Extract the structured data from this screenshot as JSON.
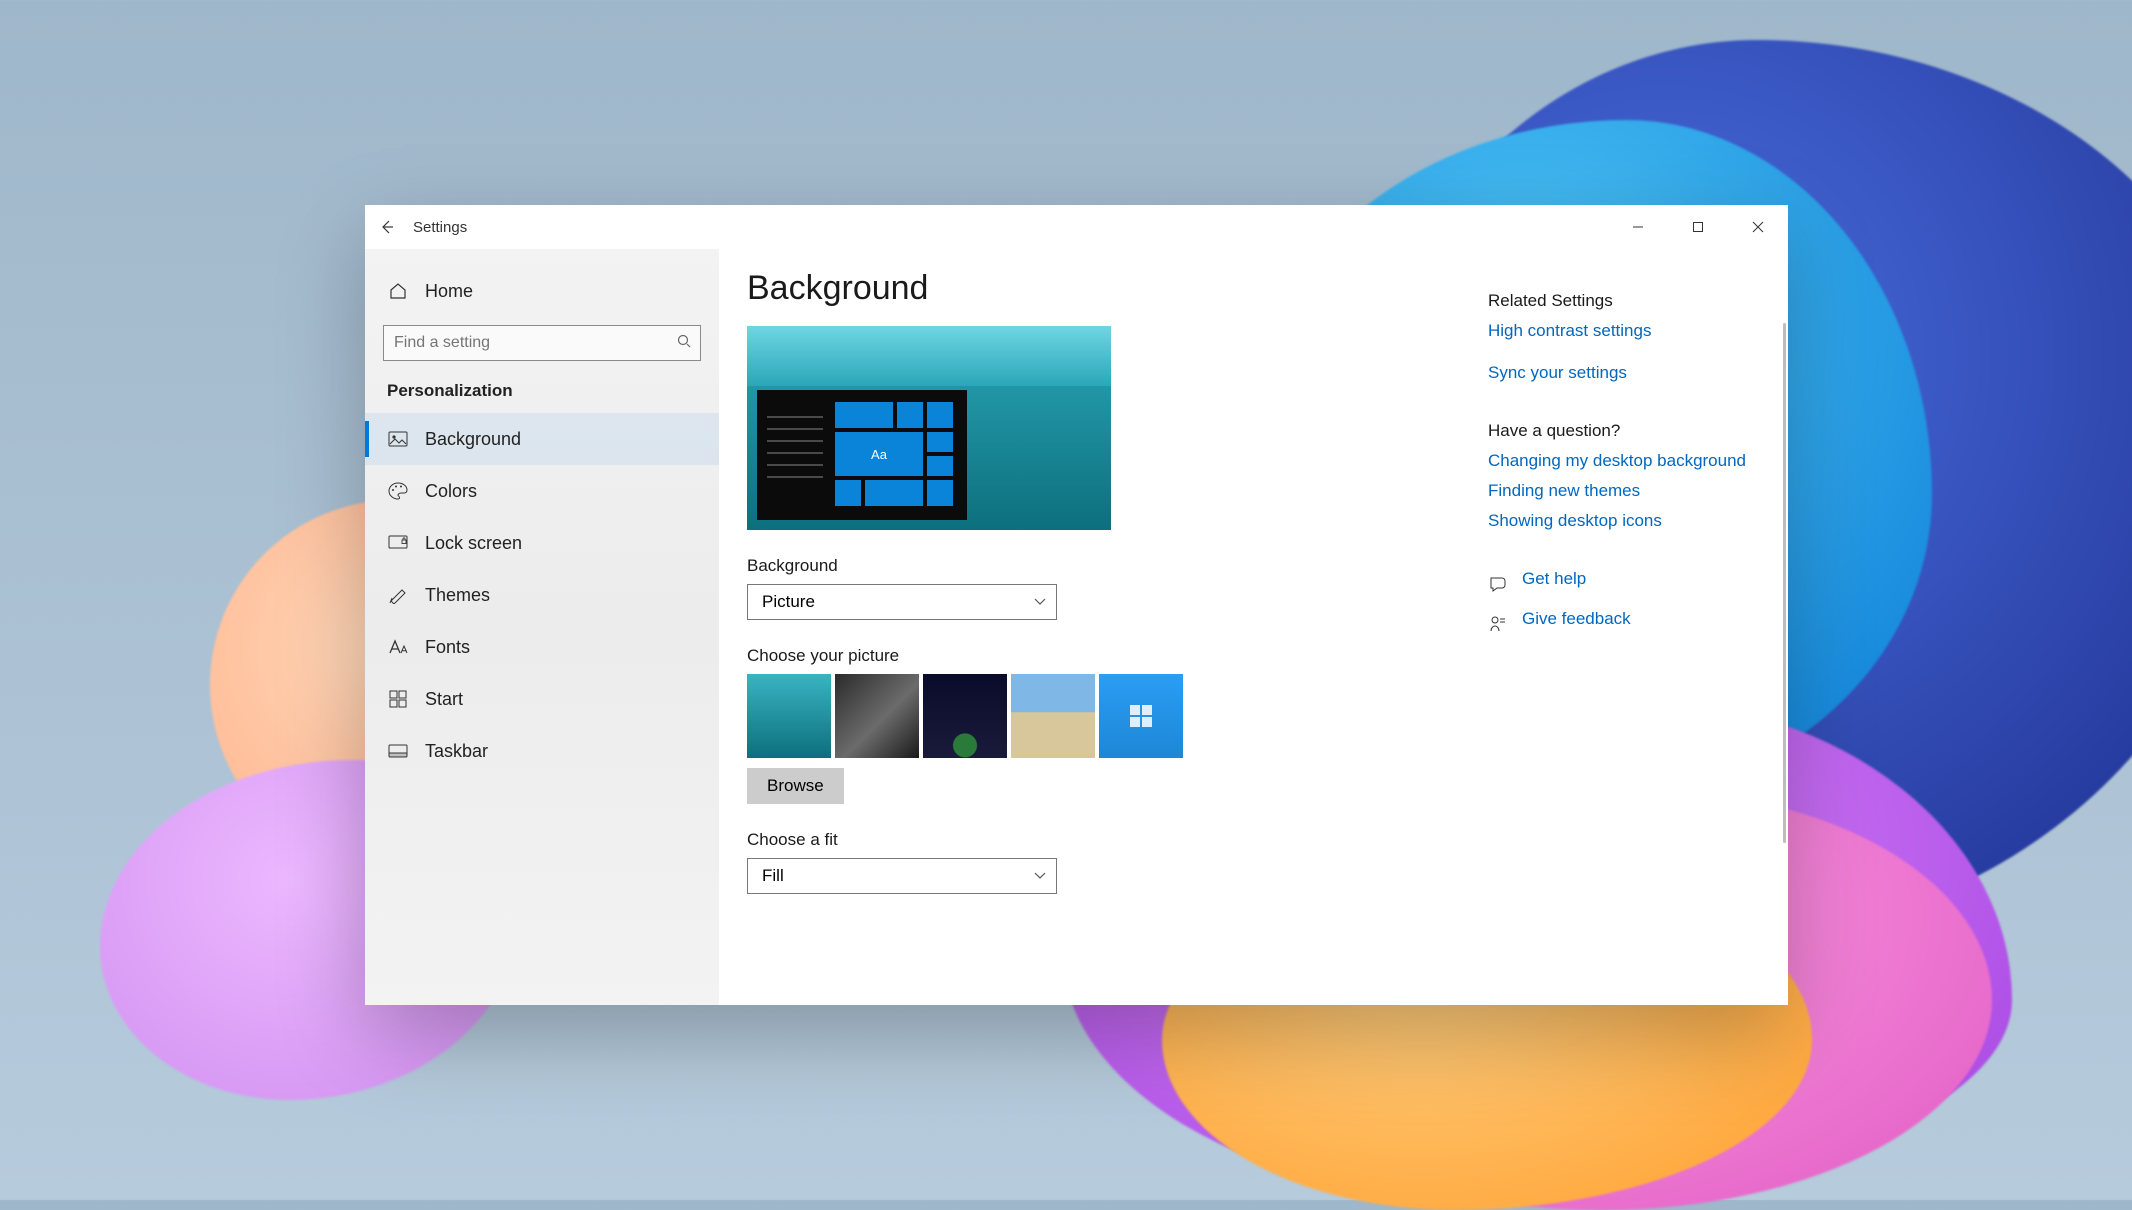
{
  "window": {
    "app_title": "Settings",
    "page_title": "Background"
  },
  "sidebar": {
    "home": "Home",
    "search_placeholder": "Find a setting",
    "category": "Personalization",
    "items": [
      {
        "label": "Background",
        "icon": "picture-icon",
        "active": true
      },
      {
        "label": "Colors",
        "icon": "palette-icon",
        "active": false
      },
      {
        "label": "Lock screen",
        "icon": "lock-screen-icon",
        "active": false
      },
      {
        "label": "Themes",
        "icon": "themes-icon",
        "active": false
      },
      {
        "label": "Fonts",
        "icon": "fonts-icon",
        "active": false
      },
      {
        "label": "Start",
        "icon": "start-icon",
        "active": false
      },
      {
        "label": "Taskbar",
        "icon": "taskbar-icon",
        "active": false
      }
    ]
  },
  "content": {
    "preview_sample_text": "Aa",
    "background_label": "Background",
    "background_value": "Picture",
    "choose_picture_label": "Choose your picture",
    "browse_label": "Browse",
    "fit_label": "Choose a fit",
    "fit_value": "Fill"
  },
  "rail": {
    "related_title": "Related Settings",
    "related_links": [
      "High contrast settings",
      "Sync your settings"
    ],
    "question_title": "Have a question?",
    "question_links": [
      "Changing my desktop background",
      "Finding new themes",
      "Showing desktop icons"
    ],
    "help_label": "Get help",
    "feedback_label": "Give feedback"
  }
}
